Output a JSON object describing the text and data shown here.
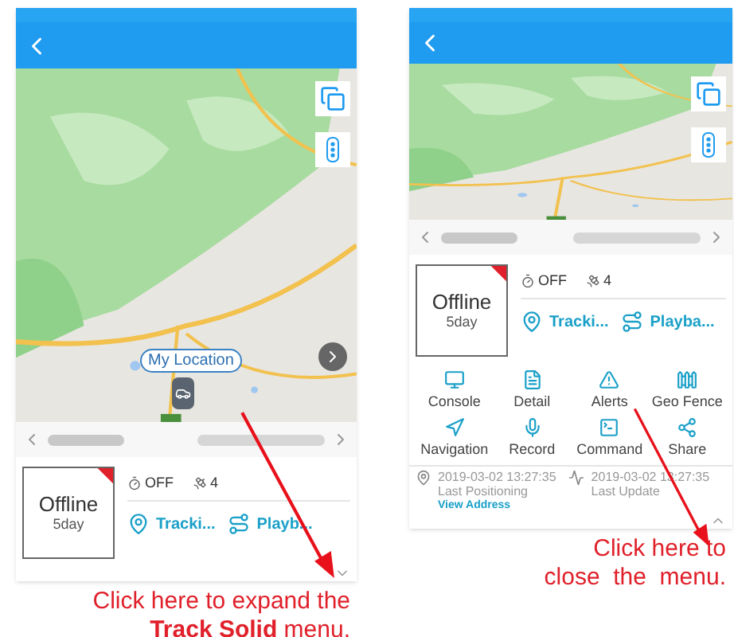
{
  "panels": [
    {
      "expanded": false,
      "my_location": "My Location",
      "status": "Offline",
      "duration": "5day",
      "acc": "OFF",
      "satellites": "4",
      "actions": [
        {
          "kind": "tracking",
          "label": "Tracki..."
        },
        {
          "kind": "playback",
          "label": "Playb..."
        }
      ],
      "caption_lines": [
        "Click here to expand the",
        "**Track Solid** menu."
      ]
    },
    {
      "expanded": true,
      "status": "Offline",
      "duration": "5day",
      "acc": "OFF",
      "satellites": "4",
      "actions": [
        {
          "kind": "tracking",
          "label": "Tracki..."
        },
        {
          "kind": "playback",
          "label": "Playba..."
        }
      ],
      "menu": [
        {
          "kind": "console",
          "label": "Console"
        },
        {
          "kind": "detail",
          "label": "Detail"
        },
        {
          "kind": "alerts",
          "label": "Alerts"
        },
        {
          "kind": "fence",
          "label": "Geo Fence"
        },
        {
          "kind": "navigation",
          "label": "Navigation"
        },
        {
          "kind": "record",
          "label": "Record"
        },
        {
          "kind": "command",
          "label": "Command"
        },
        {
          "kind": "share",
          "label": "Share"
        }
      ],
      "positioning": {
        "time": "2019-03-02 13:27:35",
        "label": "Last Positioning",
        "link": "View Address"
      },
      "update": {
        "time": "2019-03-02 13:27:35",
        "label": "Last Update"
      },
      "caption_lines": [
        "Click here to",
        "close  the  menu."
      ]
    }
  ]
}
